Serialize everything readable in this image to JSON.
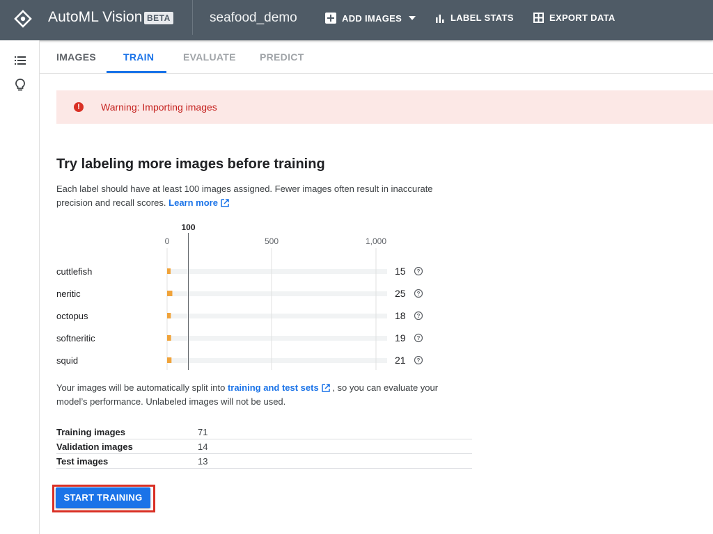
{
  "header": {
    "app_title": "AutoML Vision",
    "badge": "BETA",
    "dataset_name": "seafood_demo",
    "actions": [
      {
        "label": "ADD IMAGES",
        "icon": "add-box-icon"
      },
      {
        "label": "LABEL STATS",
        "icon": "bar-chart-icon"
      },
      {
        "label": "EXPORT DATA",
        "icon": "grid-icon"
      }
    ]
  },
  "tabs": [
    {
      "label": "IMAGES",
      "state": "normal"
    },
    {
      "label": "TRAIN",
      "state": "active"
    },
    {
      "label": "EVALUATE",
      "state": "disabled"
    },
    {
      "label": "PREDICT",
      "state": "disabled"
    }
  ],
  "warning": {
    "text": "Warning: Importing images",
    "icon": "error-icon"
  },
  "main": {
    "heading": "Try labeling more images before training",
    "description": "Each label should have at least 100 images assigned. Fewer images often result in inaccurate precision and recall scores.",
    "learn_more": "Learn more",
    "split_prefix": "Your images will be automatically split into",
    "split_link": "training and test sets",
    "split_suffix": ", so you can evaluate your model’s performance. Unlabeled images will not be used."
  },
  "chart_data": {
    "type": "bar",
    "orientation": "horizontal",
    "threshold_label": "100",
    "threshold": 100,
    "xlim": [
      0,
      1000
    ],
    "ticks": [
      {
        "value": 0,
        "label": "0"
      },
      {
        "value": 500,
        "label": "500"
      },
      {
        "value": 1000,
        "label": "1,000"
      }
    ],
    "categories": [
      "cuttlefish",
      "neritic",
      "octopus",
      "softneritic",
      "squid"
    ],
    "values": [
      15,
      25,
      18,
      19,
      21
    ],
    "bar_color": "#f0a33a",
    "track_color": "#f1f3f4"
  },
  "stats": [
    {
      "label": "Training images",
      "value": "71"
    },
    {
      "label": "Validation images",
      "value": "14"
    },
    {
      "label": "Test images",
      "value": "13"
    }
  ],
  "start_button": "START TRAINING",
  "colors": {
    "topbar": "#4f5b66",
    "accent": "#1a73e8",
    "warning_bg": "#fce8e6",
    "warning_text": "#c5221f"
  }
}
